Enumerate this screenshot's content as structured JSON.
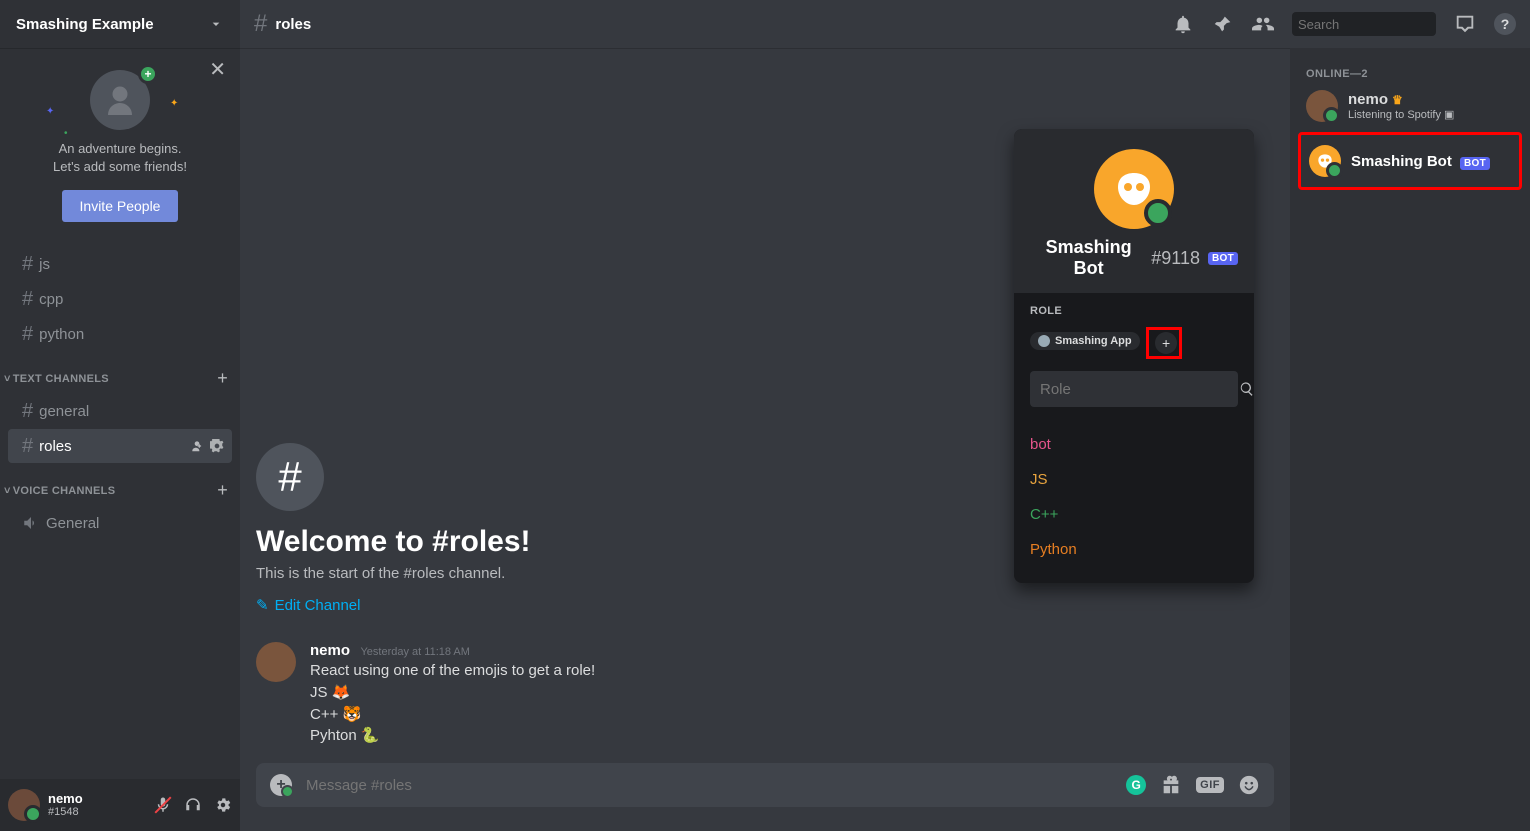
{
  "server": {
    "name": "Smashing Example"
  },
  "invite": {
    "line1": "An adventure begins.",
    "line2": "Let's add some friends!",
    "button": "Invite People"
  },
  "channels": {
    "unlabeled": [
      "js",
      "cpp",
      "python"
    ],
    "textHeader": "TEXT CHANNELS",
    "text": [
      "general",
      "roles"
    ],
    "selected": "roles",
    "voiceHeader": "VOICE CHANNELS",
    "voice": [
      "General"
    ]
  },
  "user": {
    "name": "nemo",
    "disc": "#1548"
  },
  "topbar": {
    "channel": "roles",
    "searchPlaceholder": "Search"
  },
  "welcome": {
    "title": "Welcome to #roles!",
    "sub": "This is the start of the #roles channel.",
    "edit": "Edit Channel"
  },
  "message": {
    "author": "nemo",
    "timestamp": "Yesterday at 11:18 AM",
    "l1": "React using one of the emojis to get a role!",
    "l2": "JS 🦊",
    "l3": "C++ 🐯",
    "l4": "Pyhton 🐍"
  },
  "composer": {
    "placeholder": "Message #roles",
    "gif": "GIF"
  },
  "members": {
    "header": "ONLINE—2",
    "m1": {
      "name": "nemo",
      "status": "Listening to Spotify"
    },
    "m2": {
      "name": "Smashing Bot",
      "badge": "BOT"
    }
  },
  "popout": {
    "name": "Smashing Bot",
    "disc": "#9118",
    "badge": "BOT",
    "roleLabel": "ROLE",
    "roleChip": "Smashing App",
    "searchPlaceholder": "Role",
    "options": {
      "bot": "bot",
      "js": "JS",
      "cpp": "C++",
      "py": "Python"
    }
  }
}
